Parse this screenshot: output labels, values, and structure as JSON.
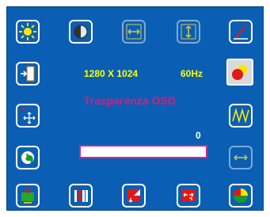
{
  "info": {
    "resolution": "1280  X  1024",
    "frequency": "60Hz"
  },
  "menu": {
    "selected_title": "Trasparenza OSD",
    "value": "0",
    "level_fraction": 0.0
  },
  "icons": [
    "brightness-icon",
    "contrast-icon",
    "horizontal-position-icon",
    "vertical-position-icon",
    "edit-icon",
    "exit-icon",
    "osd-transparency-icon",
    "move-icon",
    "waveform-icon",
    "language-icon",
    "horizontal-size-icon",
    "tv-icon",
    "tools-icon",
    "reset-icon",
    "expand-icon",
    "color-icon"
  ],
  "colors": {
    "panel": "#0a5fb4",
    "info_text": "#ffff00",
    "title_text": "#e0187a",
    "bar_border": "#cc2a8e"
  }
}
